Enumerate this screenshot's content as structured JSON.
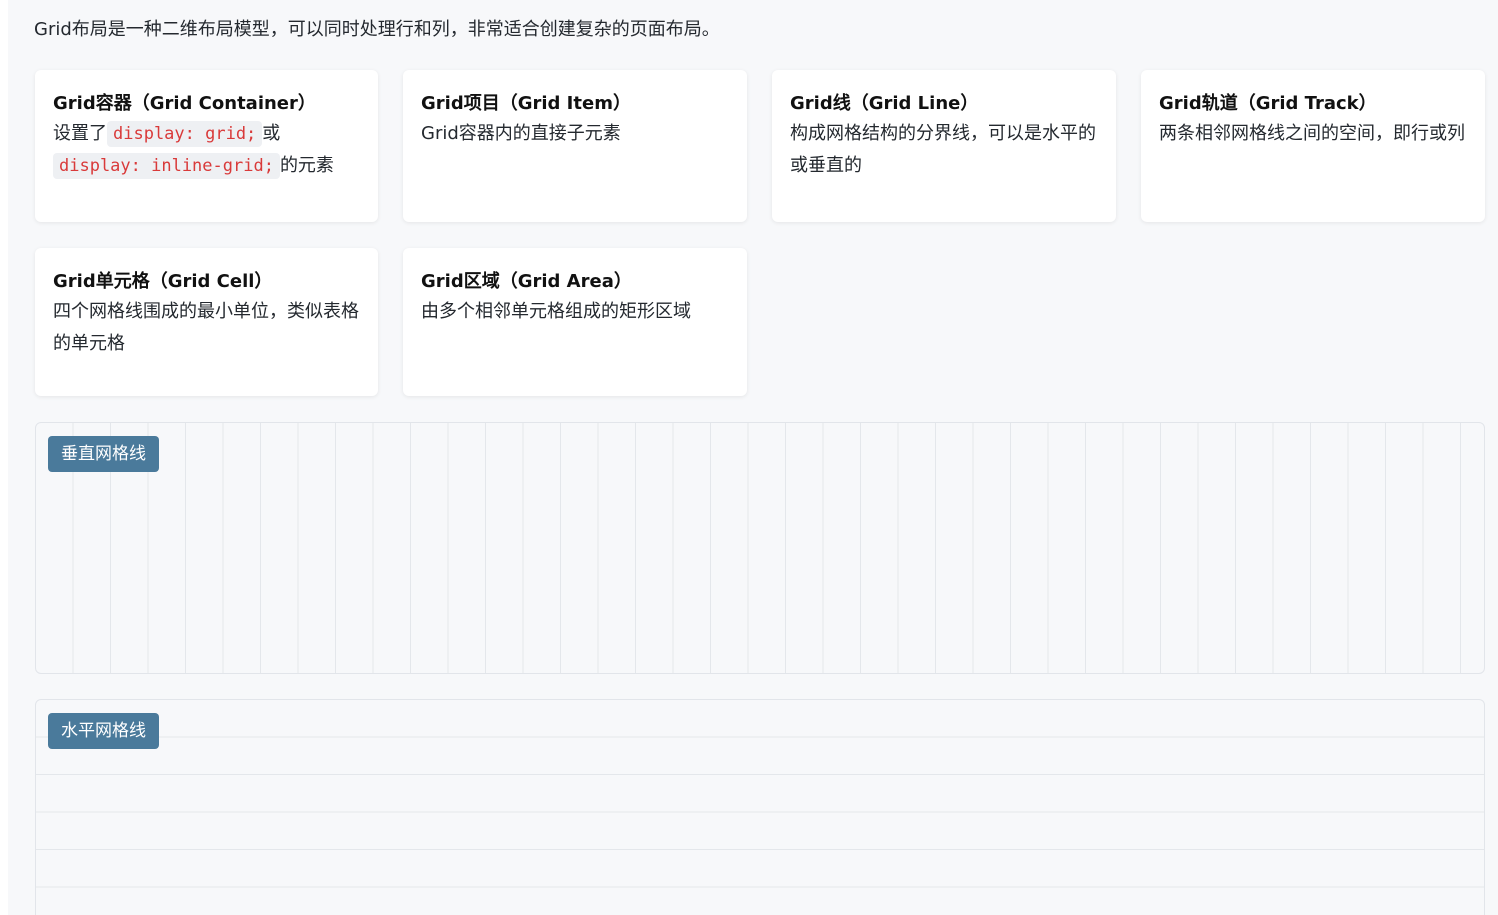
{
  "intro": "Grid布局是一种二维布局模型，可以同时处理行和列，非常适合创建复杂的页面布局。",
  "cards": [
    {
      "title": "Grid容器（Grid Container）",
      "desc_before": "设置了",
      "code1": "display: grid;",
      "desc_middle": "或",
      "code2": "display: inline-grid;",
      "desc_after": "的元素"
    },
    {
      "title": "Grid项目（Grid Item）",
      "desc": "Grid容器内的直接子元素"
    },
    {
      "title": "Grid线（Grid Line）",
      "desc": "构成网格结构的分界线，可以是水平的或垂直的"
    },
    {
      "title": "Grid轨道（Grid Track）",
      "desc": "两条相邻网格线之间的空间，即行或列"
    },
    {
      "title": "Grid单元格（Grid Cell）",
      "desc": "四个网格线围成的最小单位，类似表格的单元格"
    },
    {
      "title": "Grid区域（Grid Area）",
      "desc": "由多个相邻单元格组成的矩形区域"
    }
  ],
  "demos": {
    "vertical_label": "垂直网格线",
    "horizontal_label": "水平网格线"
  },
  "colors": {
    "badge": "#4a7a9b",
    "code_text": "#d93a3a",
    "code_bg": "#eef0f3",
    "page_bg": "#f7f8fa",
    "grid_line": "#e4e7eb"
  }
}
